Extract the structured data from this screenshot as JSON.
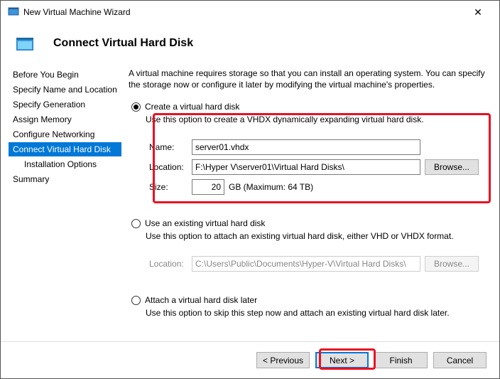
{
  "window": {
    "title": "New Virtual Machine Wizard"
  },
  "header": {
    "title": "Connect Virtual Hard Disk"
  },
  "sidebar": {
    "items": [
      {
        "label": "Before You Begin"
      },
      {
        "label": "Specify Name and Location"
      },
      {
        "label": "Specify Generation"
      },
      {
        "label": "Assign Memory"
      },
      {
        "label": "Configure Networking"
      },
      {
        "label": "Connect Virtual Hard Disk"
      },
      {
        "label": "Installation Options"
      },
      {
        "label": "Summary"
      }
    ]
  },
  "main": {
    "intro": "A virtual machine requires storage so that you can install an operating system. You can specify the storage now or configure it later by modifying the virtual machine's properties.",
    "opt1": {
      "label": "Create a virtual hard disk",
      "desc": "Use this option to create a VHDX dynamically expanding virtual hard disk.",
      "name_label": "Name:",
      "name_value": "server01.vhdx",
      "loc_label": "Location:",
      "loc_value": "F:\\Hyper V\\server01\\Virtual Hard Disks\\",
      "browse": "Browse...",
      "size_label": "Size:",
      "size_value": "20",
      "size_suffix": "GB (Maximum: 64 TB)"
    },
    "opt2": {
      "label": "Use an existing virtual hard disk",
      "desc": "Use this option to attach an existing virtual hard disk, either VHD or VHDX format.",
      "loc_label": "Location:",
      "loc_value": "C:\\Users\\Public\\Documents\\Hyper-V\\Virtual Hard Disks\\",
      "browse": "Browse..."
    },
    "opt3": {
      "label": "Attach a virtual hard disk later",
      "desc": "Use this option to skip this step now and attach an existing virtual hard disk later."
    }
  },
  "footer": {
    "previous": "< Previous",
    "next": "Next >",
    "finish": "Finish",
    "cancel": "Cancel"
  }
}
